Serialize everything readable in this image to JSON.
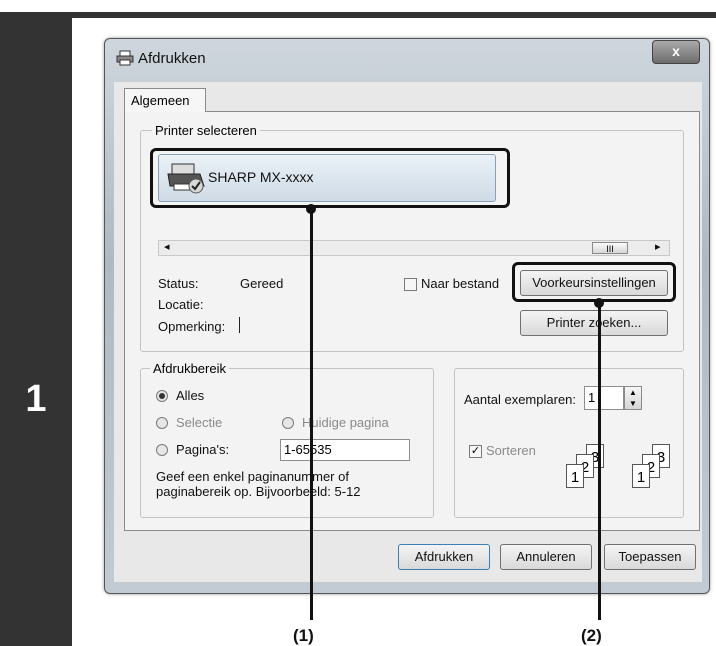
{
  "step_number": "1",
  "dialog": {
    "title": "Afdrukken",
    "close_label": "x",
    "tab_label": "Algemeen",
    "printer_group": {
      "legend": "Printer selecteren",
      "printer_name": "SHARP MX-xxxx",
      "status_label": "Status:",
      "status_value": "Gereed",
      "location_label": "Locatie:",
      "comment_label": "Opmerking:",
      "print_to_file_label": "Naar bestand",
      "preferences_button": "Voorkeursinstellingen",
      "find_printer_button": "Printer zoeken...",
      "scroll_left": "◂",
      "scroll_right": "▸",
      "scroll_grip": "III"
    },
    "range_group": {
      "legend": "Afdrukbereik",
      "all_label": "Alles",
      "selection_label": "Selectie",
      "current_page_label": "Huidige pagina",
      "pages_label": "Pagina's:",
      "pages_value": "1-65535",
      "hint": "Geef een enkel paginanummer of paginabereik op. Bijvoorbeeld: 5-12"
    },
    "copies_group": {
      "copies_label": "Aantal exemplaren:",
      "copies_value": "1",
      "collate_label": "Sorteren",
      "collate_checked": true,
      "collate_pages": [
        "1",
        "2",
        "3"
      ]
    },
    "buttons": {
      "print": "Afdrukken",
      "cancel": "Annuleren",
      "apply": "Toepassen"
    }
  },
  "callouts": {
    "one": "(1)",
    "two": "(2)"
  }
}
